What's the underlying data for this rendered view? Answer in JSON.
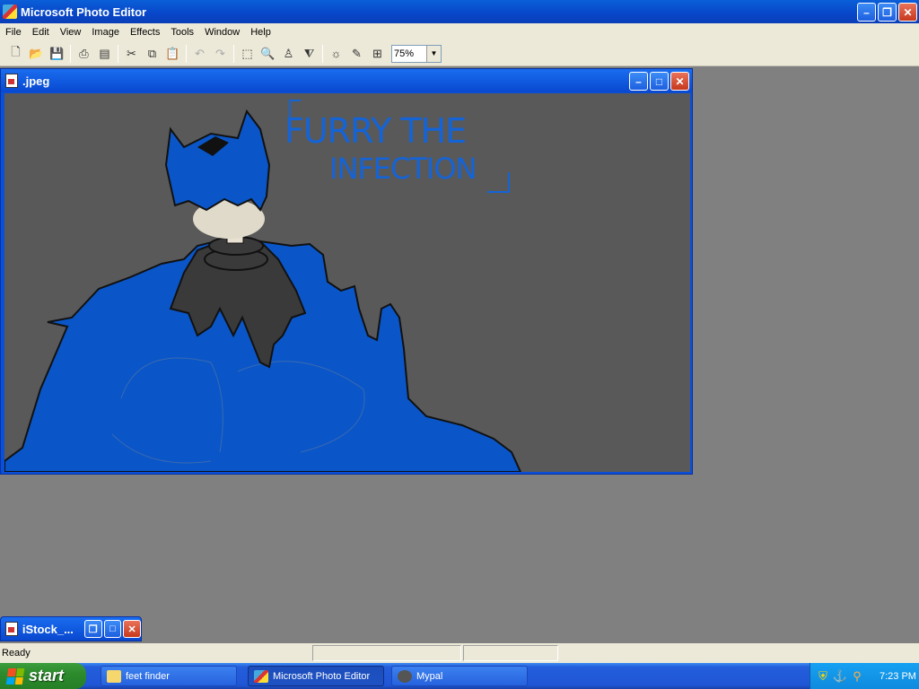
{
  "app": {
    "title": "Microsoft Photo Editor",
    "minimize": "–",
    "maximize": "❐",
    "close": "✕"
  },
  "menu": [
    "File",
    "Edit",
    "View",
    "Image",
    "Effects",
    "Tools",
    "Window",
    "Help"
  ],
  "toolbar": {
    "icons": [
      "new-icon",
      "open-icon",
      "save-icon",
      "print-icon",
      "scan-icon",
      "cut-icon",
      "copy-icon",
      "paste-icon",
      "undo-icon",
      "redo-icon",
      "select-icon",
      "zoom-icon",
      "smudge-icon",
      "sharpen-icon",
      "balance-icon",
      "retouch-icon",
      "properties-icon"
    ],
    "zoom_value": "75%"
  },
  "document": {
    "title": ".jpeg",
    "minimize": "–",
    "maximize": "□",
    "close": "✕",
    "drawing_text_line1": "FURRY THE",
    "drawing_text_line2": "INFECTION"
  },
  "minimized_window": {
    "title": "iStock_...",
    "restore": "❐",
    "maximize": "□",
    "close": "✕"
  },
  "statusbar": {
    "text": "Ready"
  },
  "taskbar": {
    "start": "start",
    "items": [
      "feet finder",
      "Microsoft Photo Editor",
      "Mypal"
    ],
    "time": "7:23 PM"
  },
  "colors": {
    "title_blue": "#0846c9",
    "canvas_bg": "#595959",
    "drawing_blue": "#0a56c8",
    "drawing_dark": "#3a3a3a"
  }
}
